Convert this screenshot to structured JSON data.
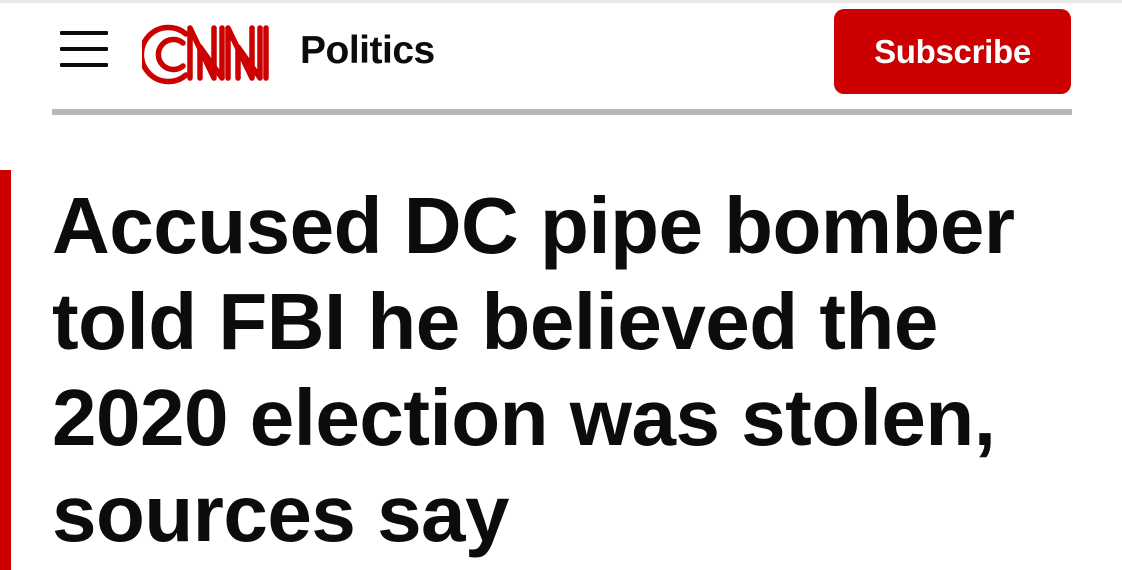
{
  "header": {
    "menu_icon": "hamburger-menu-icon",
    "logo_text": "CNN",
    "section_label": "Politics",
    "subscribe_label": "Subscribe"
  },
  "article": {
    "headline_lines": [
      "Accused DC pipe bomber",
      "told FBI he believed the",
      "2020 election was stolen,",
      "sources say"
    ]
  },
  "colors": {
    "brand_red": "#cc0000",
    "text": "#0c0c0c",
    "divider": "#b9b9b9",
    "background": "#ffffff"
  }
}
